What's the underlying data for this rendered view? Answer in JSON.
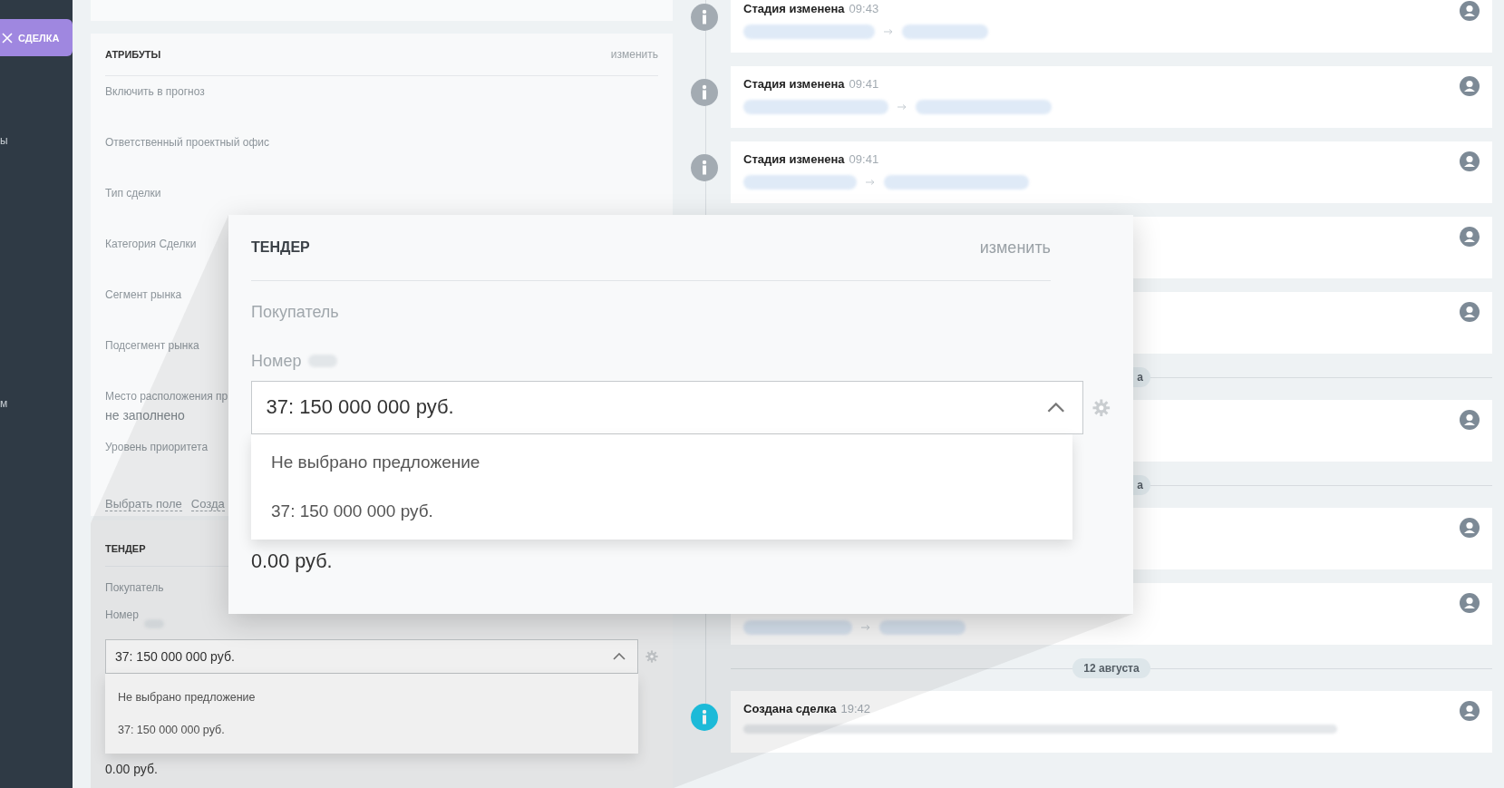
{
  "sidebar": {
    "active_tab": {
      "label": "СДЕЛКА"
    },
    "items": [
      {
        "label": "ы"
      },
      {
        "label": "м"
      }
    ]
  },
  "attributes": {
    "title": "АТРИБУТЫ",
    "action": "изменить",
    "fields": [
      {
        "label": "Включить в прогноз"
      },
      {
        "label": "Ответственный проектный офис"
      },
      {
        "label": "Тип сделки"
      },
      {
        "label": "Категория Сделки"
      },
      {
        "label": "Сегмент рынка"
      },
      {
        "label": "Подсегмент рынка"
      },
      {
        "label": "Место расположения пр",
        "value": "не заполнено"
      },
      {
        "label": "Уровень приоритета"
      }
    ],
    "links": [
      "Выбрать поле",
      "Созда"
    ]
  },
  "tender": {
    "title": "ТЕНДЕР",
    "buyer_label": "Покупатель",
    "number_label": "Номер",
    "select": {
      "value": "37: 150 000 000 руб.",
      "expanded": true
    },
    "options": [
      "Не выбрано предложение",
      "37: 150 000 000 руб."
    ],
    "amount": "0.00 руб."
  },
  "callout": {
    "title": "ТЕНДЕР",
    "action": "изменить",
    "buyer_label": "Покупатель",
    "number_label": "Номер",
    "select": {
      "value": "37: 150 000 000 руб.",
      "expanded": true
    },
    "options": [
      "Не выбрано предложение",
      "37: 150 000 000 руб."
    ],
    "amount": "0.00 руб."
  },
  "timeline": [
    {
      "kind": "stage",
      "title": "Стадия изменена",
      "time": "09:43",
      "color": "#a3abb2"
    },
    {
      "kind": "stage",
      "title": "Стадия изменена",
      "time": "09:41",
      "color": "#a3abb2"
    },
    {
      "kind": "stage",
      "title": "Стадия изменена",
      "time": "09:41",
      "color": "#a3abb2"
    },
    {
      "kind": "plain"
    },
    {
      "kind": "plain"
    },
    {
      "kind": "date",
      "label": "а",
      "covered": true
    },
    {
      "kind": "plain"
    },
    {
      "kind": "date",
      "label": "а",
      "covered": true
    },
    {
      "kind": "plain"
    },
    {
      "kind": "stage"
    },
    {
      "kind": "date",
      "label": "12 августа",
      "covered": false
    },
    {
      "kind": "note",
      "title": "Создана сделка",
      "time": "19:42",
      "color": "#1ec6e6"
    }
  ]
}
